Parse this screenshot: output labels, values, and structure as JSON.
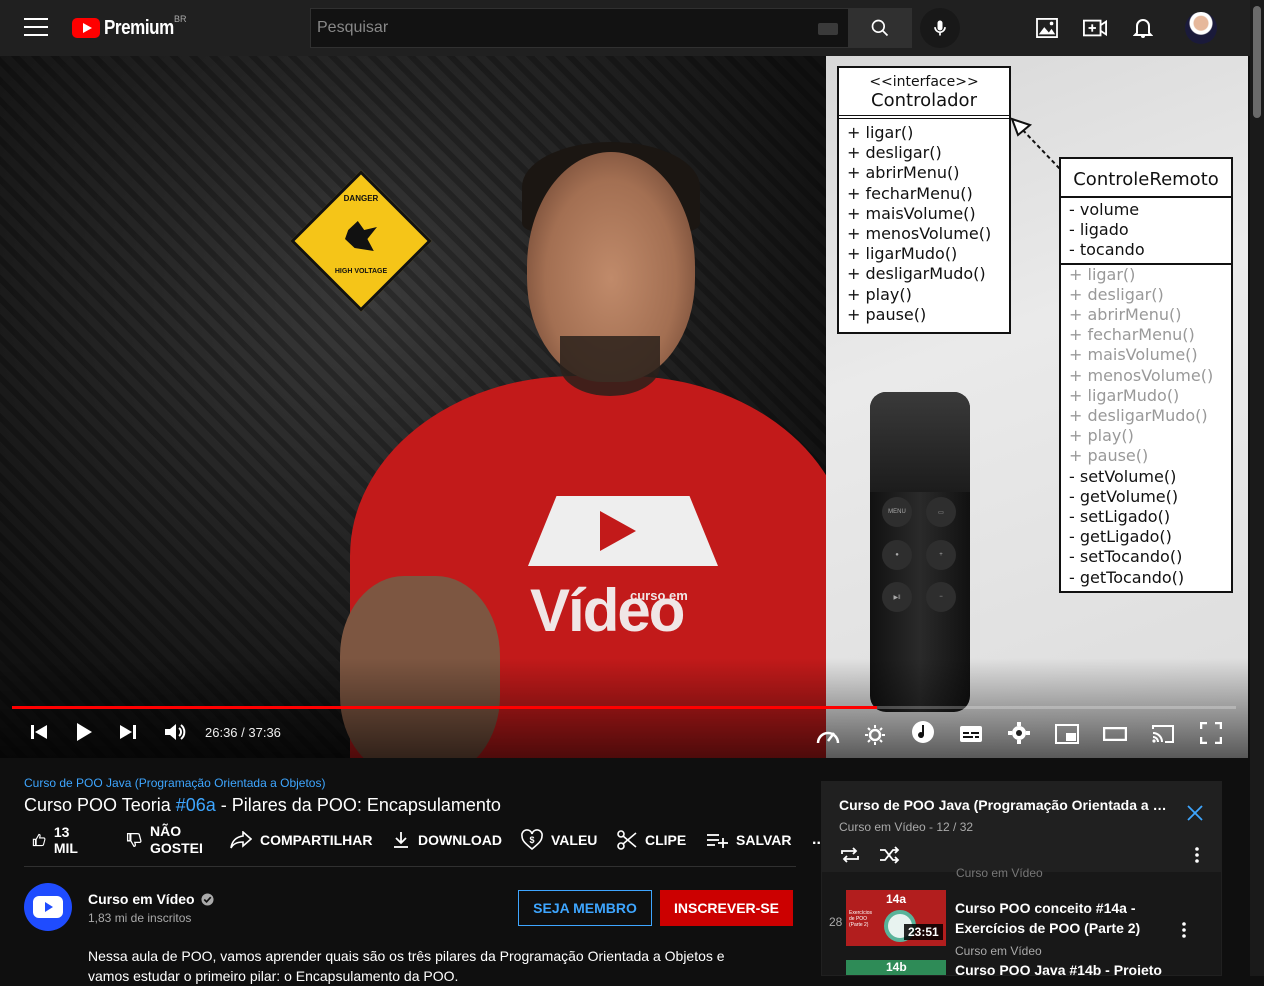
{
  "header": {
    "logo_text": "Premium",
    "region": "BR",
    "search_placeholder": "Pesquisar"
  },
  "player": {
    "time_current": "26:36",
    "time_total": "37:36",
    "time_display": "26:36 / 37:36",
    "progress_fraction": 0.707,
    "scene": {
      "sign_top": "DANGER",
      "sign_bottom": "HIGH VOLTAGE",
      "shirt_brand": "Vídeo",
      "shirt_brand_small": "curso em"
    },
    "uml_interface": {
      "stereotype": "<<interface>>",
      "name": "Controlador",
      "methods": [
        "+ ligar()",
        "+ desligar()",
        "+ abrirMenu()",
        "+ fecharMenu()",
        "+ maisVolume()",
        "+ menosVolume()",
        "+ ligarMudo()",
        "+ desligarMudo()",
        "+ play()",
        "+ pause()"
      ]
    },
    "uml_class": {
      "name": "ControleRemoto",
      "attributes": [
        "- volume",
        "- ligado",
        "- tocando"
      ],
      "inherited_methods": [
        "+ ligar()",
        "+ desligar()",
        "+ abrirMenu()",
        "+ fecharMenu()",
        "+ maisVolume()",
        "+ menosVolume()",
        "+ ligarMudo()",
        "+ desligarMudo()",
        "+ play()",
        "+ pause()"
      ],
      "methods": [
        "- setVolume()",
        "- getVolume()",
        "- setLigado()",
        "- getLigado()",
        "- setTocando()",
        "- getTocando()"
      ]
    },
    "remote_labels": {
      "menu": "MENU"
    }
  },
  "video": {
    "playlist_link": "Curso de POO Java (Programação Orientada a Objetos)",
    "title_before": "Curso POO Teoria ",
    "title_hashtag": "#06a",
    "title_after": " - Pilares da POO: Encapsulamento",
    "likes": "13 MIL",
    "dislike_label": "NÃO GOSTEI",
    "share_label": "COMPARTILHAR",
    "download_label": "DOWNLOAD",
    "thanks_label": "VALEU",
    "clip_label": "CLIPE",
    "save_label": "SALVAR",
    "more_label": "..."
  },
  "channel": {
    "name": "Curso em Vídeo",
    "subscribers": "1,83 mi de inscritos",
    "member_button": "SEJA MEMBRO",
    "subscribe_button": "INSCREVER-SE",
    "description": "Nessa aula de POO, vamos aprender quais são os três pilares da Programação Orientada a Objetos e vamos estudar o primeiro pilar: o Encapsulamento da POO."
  },
  "playlist_panel": {
    "title": "Curso de POO Java (Programação Orientada a Objetos)",
    "channel": "Curso em Vídeo",
    "position": "12 / 32",
    "subtitle": "Curso em Vídeo - 12 / 32",
    "cut_item_channel": "Curso em Vídeo",
    "items": [
      {
        "index": "28",
        "thumb_label": "14a",
        "thumb_small": "Exercícios de POO (Parte 2)",
        "duration": "23:51",
        "title": "Curso POO conceito #14a - Exercícios de POO (Parte 2)",
        "channel": "Curso em Vídeo"
      },
      {
        "index": "",
        "thumb_label": "14b",
        "title": "Curso POO Java #14b - Projeto"
      }
    ]
  },
  "colors": {
    "accent_blue": "#3ea6ff",
    "brand_red": "#ff0000",
    "subscribe_red": "#cc0000",
    "progress_red": "#ff0000"
  }
}
